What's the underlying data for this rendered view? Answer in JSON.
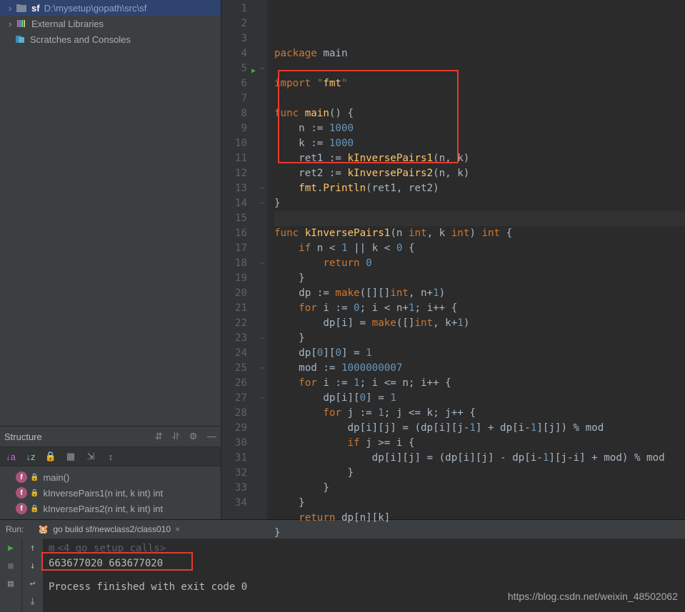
{
  "project": {
    "root_label": "sf",
    "root_path": "D:\\mysetup\\gopath\\src\\sf",
    "node_external": "External Libraries",
    "node_scratches": "Scratches and Consoles"
  },
  "structure": {
    "title": "Structure",
    "items": [
      {
        "name": "main()"
      },
      {
        "name": "kInversePairs1(n int, k int) int"
      },
      {
        "name": "kInversePairs2(n int, k int) int"
      }
    ],
    "toolbar": {
      "sortAlpha": "a↓z",
      "sortVis": "↓↑"
    }
  },
  "editor": {
    "lines": [
      "package main",
      "",
      "import \"fmt\"",
      "",
      "func main() {",
      "    n := 1000",
      "    k := 1000",
      "    ret1 := kInversePairs1(n, k)",
      "    ret2 := kInversePairs2(n, k)",
      "    fmt.Println(ret1, ret2)",
      "}",
      "",
      "func kInversePairs1(n int, k int) int {",
      "    if n < 1 || k < 0 {",
      "        return 0",
      "    }",
      "    dp := make([][]int, n+1)",
      "    for i := 0; i < n+1; i++ {",
      "        dp[i] = make([]int, k+1)",
      "    }",
      "    dp[0][0] = 1",
      "    mod := 1000000007",
      "    for i := 1; i <= n; i++ {",
      "        dp[i][0] = 1",
      "        for j := 1; j <= k; j++ {",
      "            dp[i][j] = (dp[i][j-1] + dp[i-1][j]) % mod",
      "            if j >= i {",
      "                dp[i][j] = (dp[i][j] - dp[i-1][j-i] + mod) % mod",
      "            }",
      "        }",
      "    }",
      "    return dp[n][k]",
      "}",
      ""
    ],
    "line_start": 1,
    "line_end": 34,
    "caret_line": 12
  },
  "run": {
    "label": "Run:",
    "tab": "go build sf/newclass2/class010",
    "setup_line": "<4 go setup calls>",
    "output_line": "663677020 663677020",
    "finished_line": "Process finished with exit code 0"
  },
  "watermark": "https://blog.csdn.net/weixin_48502062"
}
